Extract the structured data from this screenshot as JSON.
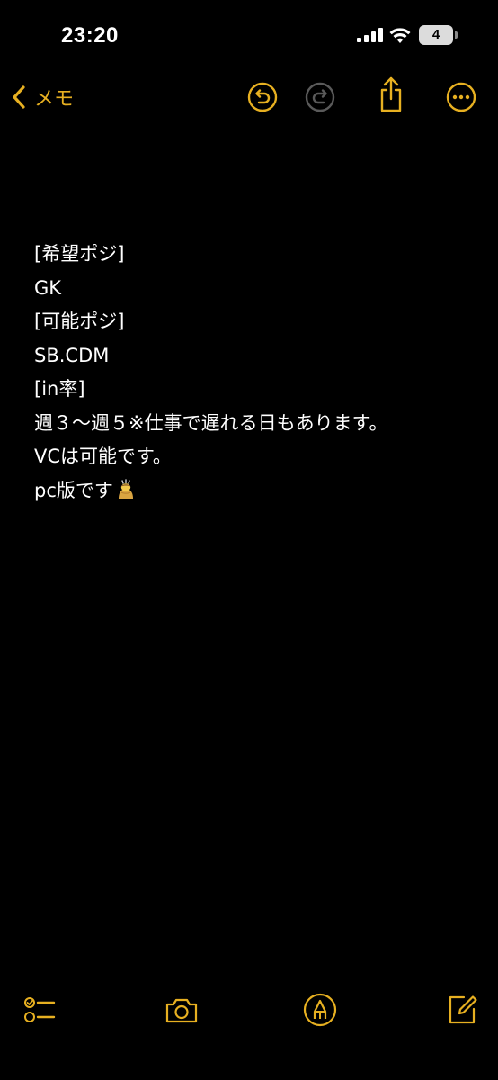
{
  "status_bar": {
    "time": "23:20",
    "battery_level": "4",
    "icons": [
      "signal-bars-icon",
      "wifi-icon",
      "battery-icon"
    ]
  },
  "nav": {
    "back_label": "メモ",
    "icons": [
      "back-chevron-icon",
      "undo-icon",
      "redo-icon",
      "share-icon",
      "more-icon"
    ]
  },
  "note": {
    "lines": [
      "[希望ポジ]",
      "GK",
      "[可能ポジ]",
      "SB.CDM",
      "[in率]",
      "週３〜週５※仕事で遅れる日もあります。",
      "VCは可能です。",
      "pc版です"
    ],
    "trailing_emoji": "person-bowing-emoji"
  },
  "toolbar": {
    "icons": [
      "checklist-icon",
      "camera-icon",
      "markup-pen-icon",
      "compose-icon"
    ]
  },
  "colors": {
    "accent": "#e7b021",
    "background": "#000000",
    "text": "#ffffff",
    "disabled": "#5a5a5a"
  }
}
